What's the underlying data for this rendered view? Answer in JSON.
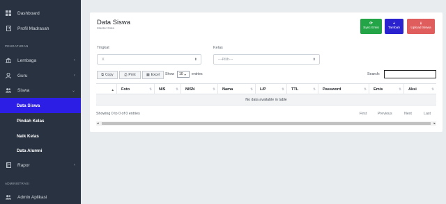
{
  "sidebar": {
    "dashboard": "Dashboard",
    "profil": "Profil Madrasah",
    "header_pengaturan": "PENGATURAN",
    "lembaga": "Lembaga",
    "guru": "Guru",
    "siswa": "Siswa",
    "sub_siswa": [
      "Data Siswa",
      "Pindah Kelas",
      "Naik Kelas",
      "Data Alumni"
    ],
    "rapor": "Rapor",
    "header_administrasi": "ADMINISTRASI",
    "admin": "Admin Aplikasi"
  },
  "page": {
    "title": "Data Siswa",
    "subtitle": "Master Data",
    "btn_sync": "Sync Emis",
    "btn_tambah": "Tambah",
    "btn_upload": "Upload Siswa"
  },
  "filters": {
    "tingkat_label": "Tingkat",
    "tingkat_value": "X",
    "kelas_label": "Kelas",
    "kelas_value": "---Pilih---"
  },
  "table_tools": {
    "copy": "Copy",
    "print": "Print",
    "excel": "Excel",
    "show": "Show",
    "entries_value": "10",
    "entries": "entries",
    "search_label": "Search:"
  },
  "table": {
    "columns": [
      "",
      "Foto",
      "NIS",
      "NISN",
      "Nama",
      "L/P",
      "TTL",
      "Password",
      "Emis",
      "Aksi"
    ],
    "empty": "No data available in table",
    "info": "Showing 0 to 0 of 0 entries",
    "pagination": [
      "First",
      "Previous",
      "Next",
      "Last"
    ]
  },
  "colors": {
    "sidebar_bg": "#283241",
    "active_item": "#2d1ee6",
    "sync_btn": "#22a447",
    "tambah_btn": "#2a21cf",
    "upload_btn": "#e05d5d"
  }
}
